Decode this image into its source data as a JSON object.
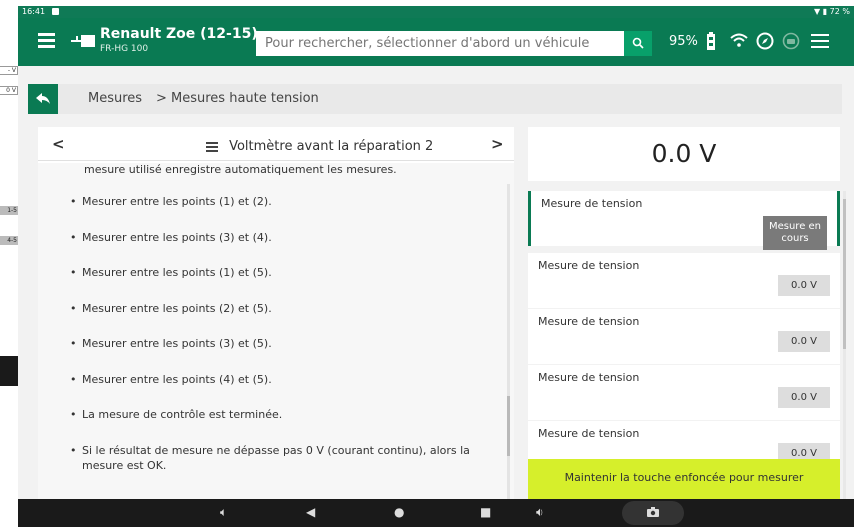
{
  "statusbar": {
    "time": "16:41",
    "battery": "72 %"
  },
  "topbar": {
    "vehicle_title": "Renault Zoe (12-15)",
    "vehicle_subtitle": "FR-HG 100",
    "search_placeholder": "Pour rechercher, sélectionner d'abord un véhicule",
    "battery_level": "95%",
    "accent_color": "#0a7a53"
  },
  "breadcrumb": {
    "level1": "Mesures",
    "level2": "> Mesures haute tension"
  },
  "document": {
    "title": "Voltmètre avant la réparation 2",
    "intro": "mesure utilisé enregistre automatiquement les mesures.",
    "steps": [
      "Mesurer entre les points (1) et (2).",
      "Mesurer entre les points (3) et (4).",
      "Mesurer entre les points (1) et (5).",
      "Mesurer entre les points (2) et (5).",
      "Mesurer entre les points (3) et (5).",
      "Mesurer entre les points (4) et (5).",
      "La mesure de contrôle est terminée.",
      "Si le résultat de mesure ne dépasse pas 0 V (courant continu), alors la mesure est OK."
    ]
  },
  "readout": {
    "value": "0.0 V"
  },
  "measurements": [
    {
      "label": "Mesure de tension",
      "value": "Mesure en cours",
      "state": "running"
    },
    {
      "label": "Mesure de tension",
      "value": "0.0 V",
      "state": "done"
    },
    {
      "label": "Mesure de tension",
      "value": "0.0 V",
      "state": "done"
    },
    {
      "label": "Mesure de tension",
      "value": "0.0 V",
      "state": "done"
    },
    {
      "label": "Mesure de tension",
      "value": "0.0 V",
      "state": "done"
    }
  ],
  "hold_bar": {
    "text": "Maintenir la touche enfoncée pour mesurer",
    "color": "#d6ef2b"
  },
  "background_app": {
    "chips": [
      "- V",
      "0 V"
    ],
    "tags": [
      "1-5",
      "4-5"
    ]
  },
  "icons": {
    "menu": "menu-icon",
    "plug": "plug-icon",
    "search": "search-icon",
    "battery": "battery-icon",
    "wifi": "wifi-icon",
    "compass": "compass-icon",
    "car": "car-icon",
    "hamburger": "hamburger-icon",
    "back": "back-arrow-icon",
    "list": "list-icon",
    "camera": "camera-icon"
  }
}
